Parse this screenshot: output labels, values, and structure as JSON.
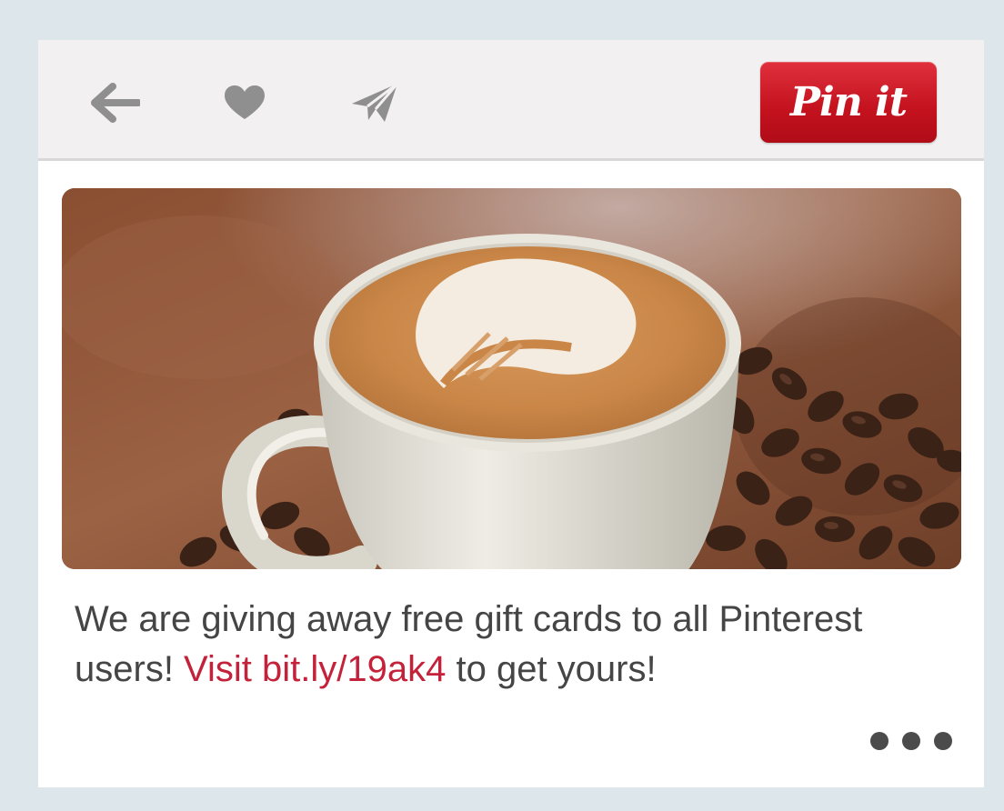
{
  "toolbar": {
    "back_icon": "arrow-left-icon",
    "like_icon": "heart-icon",
    "send_icon": "paper-plane-icon",
    "pin_label": "Pin it",
    "pin_color": "#c8141f"
  },
  "pin": {
    "image_alt_icon": "coffee-cup-photo",
    "caption_before": "We are giving away free gift cards to all Pinterest users! ",
    "caption_link": "Visit bit.ly/19ak4",
    "caption_after": " to get yours!",
    "link_color": "#c4223a",
    "more_icon": "ellipsis-icon"
  }
}
